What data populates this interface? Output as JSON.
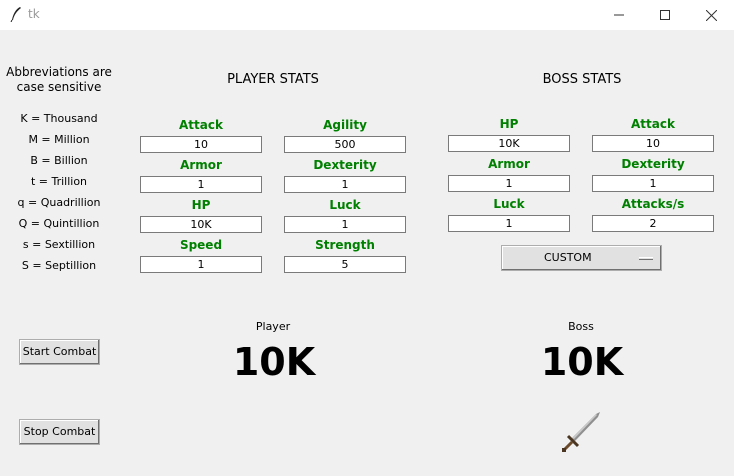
{
  "window": {
    "title": "tk"
  },
  "abbrev": {
    "heading_line1": "Abbreviations are",
    "heading_line2": "case sensitive",
    "items": [
      "K = Thousand",
      "M = Million",
      "B = Billion",
      "t = Trillion",
      "q = Quadrillion",
      "Q = Quintillion",
      "s = Sextillion",
      "S = Septillion"
    ]
  },
  "player": {
    "heading": "PLAYER STATS",
    "fields": [
      {
        "label": "Attack",
        "value": "10"
      },
      {
        "label": "Agility",
        "value": "500"
      },
      {
        "label": "Armor",
        "value": "1"
      },
      {
        "label": "Dexterity",
        "value": "1"
      },
      {
        "label": "HP",
        "value": "10K"
      },
      {
        "label": "Luck",
        "value": "1"
      },
      {
        "label": "Speed",
        "value": "1"
      },
      {
        "label": "Strength",
        "value": "5"
      }
    ],
    "name_label": "Player",
    "hp_display": "10K"
  },
  "boss": {
    "heading": "BOSS STATS",
    "fields": [
      {
        "label": "HP",
        "value": "10K"
      },
      {
        "label": "Attack",
        "value": "10"
      },
      {
        "label": "Armor",
        "value": "1"
      },
      {
        "label": "Dexterity",
        "value": "1"
      },
      {
        "label": "Luck",
        "value": "1"
      },
      {
        "label": "Attacks/s",
        "value": "2"
      }
    ],
    "preset": "CUSTOM",
    "name_label": "Boss",
    "hp_display": "10K"
  },
  "controls": {
    "start": "Start Combat",
    "stop": "Stop Combat"
  }
}
